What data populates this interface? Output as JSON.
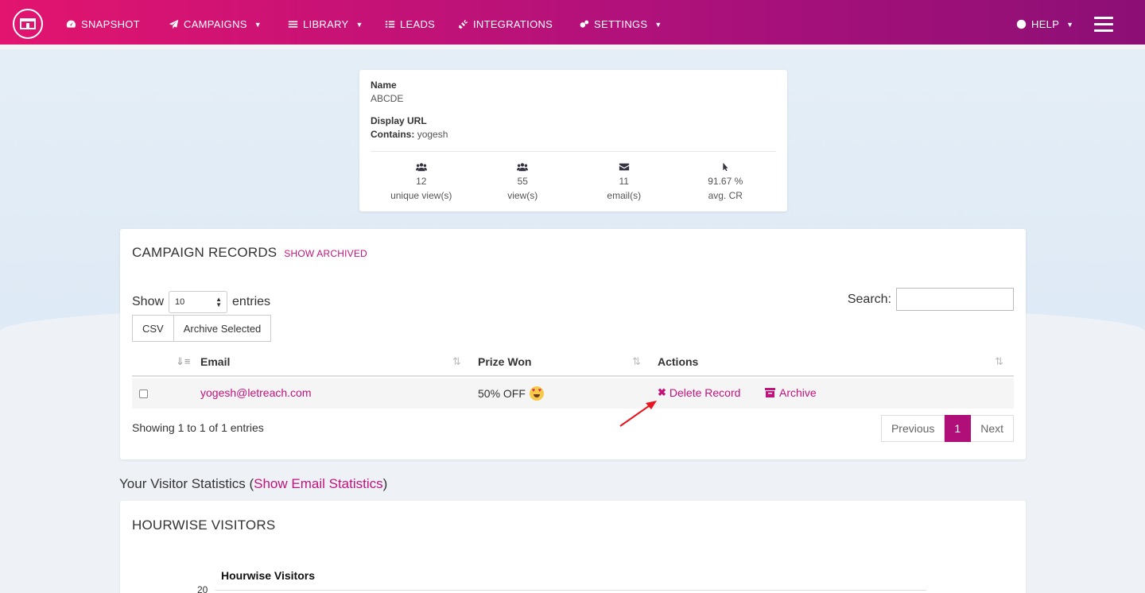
{
  "nav": {
    "items": [
      {
        "label": "SNAPSHOT",
        "icon": "dashboard-icon"
      },
      {
        "label": "CAMPAIGNS",
        "icon": "paper-plane-icon",
        "dropdown": true
      },
      {
        "label": "LIBRARY",
        "icon": "library-icon",
        "dropdown": true
      },
      {
        "label": "LEADS",
        "icon": "list-icon"
      },
      {
        "label": "INTEGRATIONS",
        "icon": "plug-icon"
      },
      {
        "label": "SETTINGS",
        "icon": "cogs-icon",
        "dropdown": true
      }
    ],
    "help": "HELP",
    "brand_gradient": [
      "#e2146f",
      "#8c0f76"
    ]
  },
  "summary": {
    "name_label": "Name",
    "name_value": "ABCDE",
    "url_label": "Display URL",
    "contains_label": "Contains:",
    "contains_value": "yogesh",
    "stats": [
      {
        "value": "12",
        "label": "unique view(s)",
        "icon": "users-icon"
      },
      {
        "value": "55",
        "label": "view(s)",
        "icon": "users-icon"
      },
      {
        "value": "11",
        "label": "email(s)",
        "icon": "envelope-icon"
      },
      {
        "value": "91.67 %",
        "label": "avg. CR",
        "icon": "cursor-icon"
      }
    ]
  },
  "records": {
    "title": "CAMPAIGN RECORDS",
    "show_archived": "SHOW ARCHIVED",
    "show_label": "Show",
    "entries_value": "10",
    "entries_label": "entries",
    "search_label": "Search:",
    "buttons": {
      "csv": "CSV",
      "archive_selected": "Archive Selected"
    },
    "columns": {
      "email": "Email",
      "prize": "Prize Won",
      "actions": "Actions"
    },
    "rows": [
      {
        "email": "yogesh@letreach.com",
        "prize": "50% OFF",
        "delete": "Delete Record",
        "archive": "Archive"
      }
    ],
    "info": "Showing 1 to 1 of 1 entries",
    "pager": {
      "previous": "Previous",
      "page": "1",
      "next": "Next"
    }
  },
  "visitor": {
    "prefix": "Your Visitor Statistics (",
    "link": "Show Email Statistics",
    "suffix": ")"
  },
  "hourwise": {
    "title": "HOURWISE VISITORS",
    "chart_title": "Hourwise Visitors",
    "tick": "20"
  },
  "accent": "#c2137d"
}
